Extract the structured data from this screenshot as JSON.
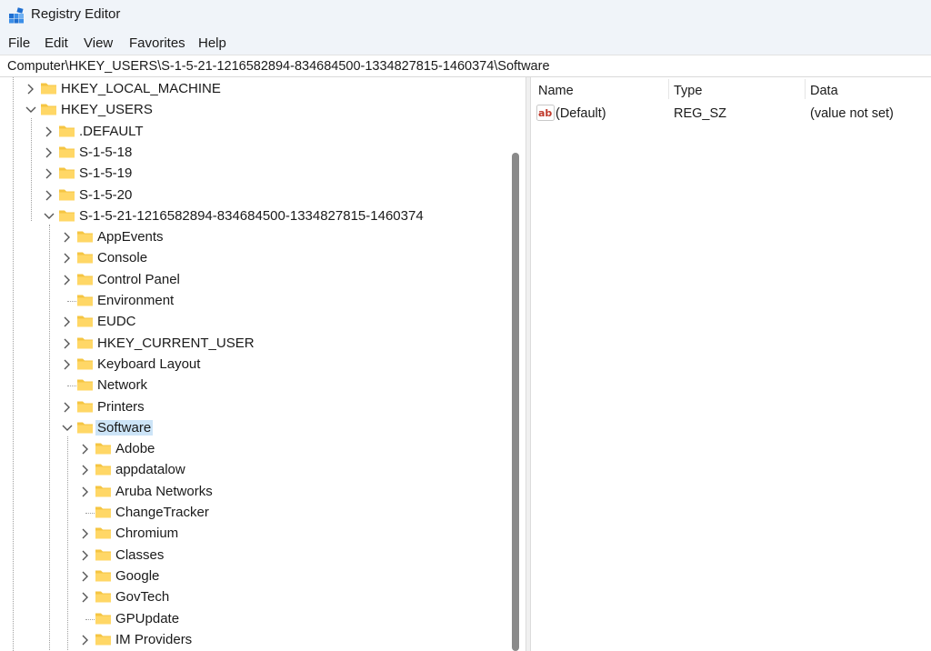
{
  "window": {
    "title": "Registry Editor",
    "app_icon": "registry-editor-icon"
  },
  "menu": [
    "File",
    "Edit",
    "View",
    "Favorites",
    "Help"
  ],
  "address": "Computer\\HKEY_USERS\\S-1-5-21-1216582894-834684500-1334827815-1460374\\Software",
  "tree": [
    {
      "label": "HKEY_LOCAL_MACHINE",
      "level": 0,
      "expanded": false,
      "has_children": true
    },
    {
      "label": "HKEY_USERS",
      "level": 0,
      "expanded": true,
      "has_children": true
    },
    {
      "label": ".DEFAULT",
      "level": 1,
      "expanded": false,
      "has_children": true
    },
    {
      "label": "S-1-5-18",
      "level": 1,
      "expanded": false,
      "has_children": true
    },
    {
      "label": "S-1-5-19",
      "level": 1,
      "expanded": false,
      "has_children": true
    },
    {
      "label": "S-1-5-20",
      "level": 1,
      "expanded": false,
      "has_children": true
    },
    {
      "label": "S-1-5-21-1216582894-834684500-1334827815-1460374",
      "level": 1,
      "expanded": true,
      "has_children": true
    },
    {
      "label": "AppEvents",
      "level": 2,
      "expanded": false,
      "has_children": true
    },
    {
      "label": "Console",
      "level": 2,
      "expanded": false,
      "has_children": true
    },
    {
      "label": "Control Panel",
      "level": 2,
      "expanded": false,
      "has_children": true
    },
    {
      "label": "Environment",
      "level": 2,
      "expanded": false,
      "has_children": false
    },
    {
      "label": "EUDC",
      "level": 2,
      "expanded": false,
      "has_children": true
    },
    {
      "label": "HKEY_CURRENT_USER",
      "level": 2,
      "expanded": false,
      "has_children": true
    },
    {
      "label": "Keyboard Layout",
      "level": 2,
      "expanded": false,
      "has_children": true
    },
    {
      "label": "Network",
      "level": 2,
      "expanded": false,
      "has_children": false
    },
    {
      "label": "Printers",
      "level": 2,
      "expanded": false,
      "has_children": true
    },
    {
      "label": "Software",
      "level": 2,
      "expanded": true,
      "has_children": true,
      "selected": true
    },
    {
      "label": "Adobe",
      "level": 3,
      "expanded": false,
      "has_children": true
    },
    {
      "label": "appdatalow",
      "level": 3,
      "expanded": false,
      "has_children": true
    },
    {
      "label": "Aruba Networks",
      "level": 3,
      "expanded": false,
      "has_children": true
    },
    {
      "label": "ChangeTracker",
      "level": 3,
      "expanded": false,
      "has_children": false
    },
    {
      "label": "Chromium",
      "level": 3,
      "expanded": false,
      "has_children": true
    },
    {
      "label": "Classes",
      "level": 3,
      "expanded": false,
      "has_children": true
    },
    {
      "label": "Google",
      "level": 3,
      "expanded": false,
      "has_children": true
    },
    {
      "label": "GovTech",
      "level": 3,
      "expanded": false,
      "has_children": true
    },
    {
      "label": "GPUpdate",
      "level": 3,
      "expanded": false,
      "has_children": false
    },
    {
      "label": "IM Providers",
      "level": 3,
      "expanded": false,
      "has_children": true
    }
  ],
  "values_list": {
    "columns": [
      "Name",
      "Type",
      "Data"
    ],
    "rows": [
      {
        "name": "(Default)",
        "type": "REG_SZ",
        "data": "(value not set)",
        "icon": "string-value-icon"
      }
    ]
  },
  "colors": {
    "folder": "#f5c542",
    "selection": "#cce4f7",
    "titlebar": "#f0f4f9",
    "scroll_thumb": "#8a8a8a"
  }
}
